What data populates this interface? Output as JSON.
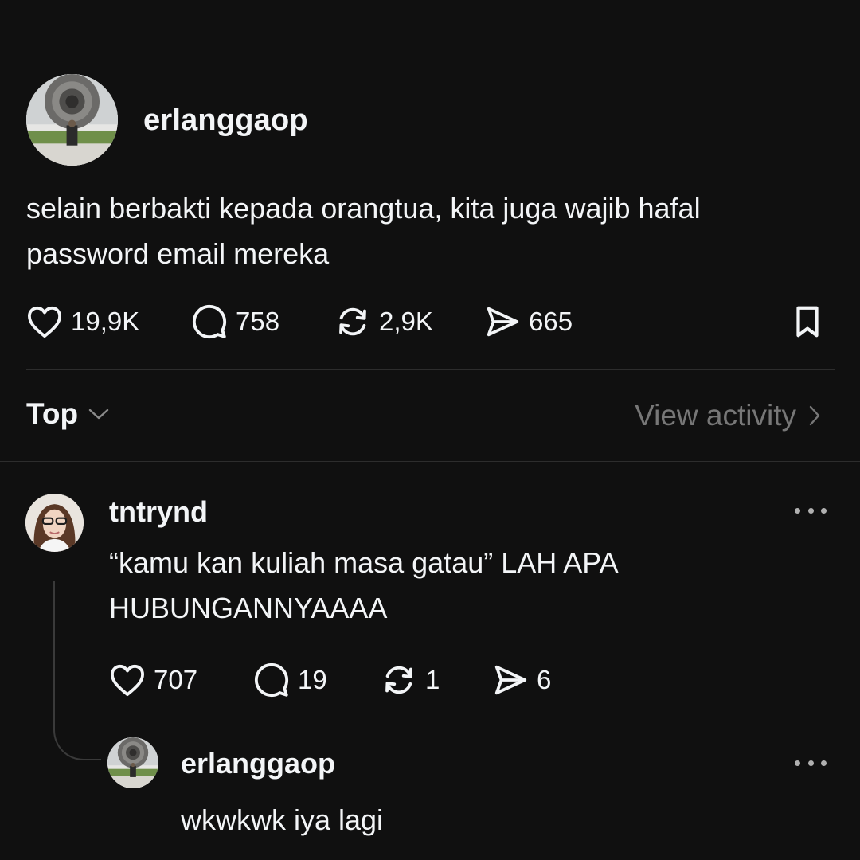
{
  "post": {
    "username": "erlanggaop",
    "text": "selain berbakti kepada orangtua, kita juga wajib hafal password email mereka",
    "stats": {
      "likes": "19,9K",
      "comments": "758",
      "reposts": "2,9K",
      "shares": "665"
    }
  },
  "sort": {
    "label": "Top",
    "view_activity": "View activity"
  },
  "comment": {
    "username": "tntrynd",
    "text": "“kamu kan kuliah masa gatau” LAH APA HUBUNGANNYAAAA",
    "stats": {
      "likes": "707",
      "comments": "19",
      "reposts": "1",
      "shares": "6"
    }
  },
  "reply": {
    "username": "erlanggaop",
    "text": "wkwkwk iya lagi"
  },
  "icons": {
    "like": "heart-icon",
    "comment": "comment-bubble-icon",
    "repost": "repost-icon",
    "share": "send-icon",
    "save": "bookmark-icon",
    "sort": "chevron-down-icon",
    "activity": "chevron-right-icon",
    "more": "more-dots-icon"
  },
  "colors": {
    "background": "#101010",
    "text": "#f3f5f7",
    "muted": "#777777",
    "divider": "#2d2d2d"
  }
}
